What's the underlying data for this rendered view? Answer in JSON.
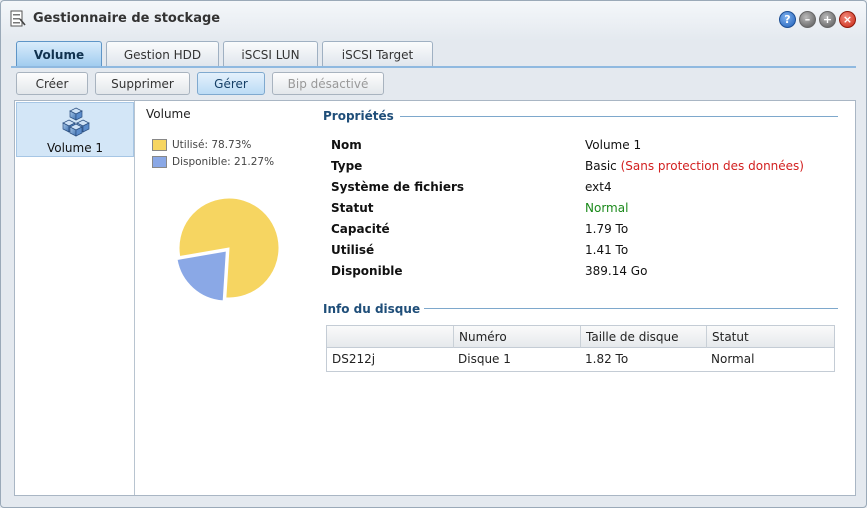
{
  "window": {
    "title": "Gestionnaire de stockage"
  },
  "tabs": [
    {
      "label": "Volume"
    },
    {
      "label": "Gestion HDD"
    },
    {
      "label": "iSCSI LUN"
    },
    {
      "label": "iSCSI Target"
    }
  ],
  "toolbar": {
    "create": "Créer",
    "delete": "Supprimer",
    "manage": "Gérer",
    "beep": "Bip désactivé"
  },
  "sidebar": {
    "items": [
      {
        "label": "Volume 1"
      }
    ]
  },
  "usage_chart": {
    "title": "Volume",
    "used_label": "Utilisé: 78.73%",
    "available_label": "Disponible: 21.27%",
    "used_fraction": 0.7873,
    "available_fraction": 0.2127,
    "used_color": "#f6d561",
    "available_color": "#8aa8e6"
  },
  "properties": {
    "section_title": "Propriétés",
    "rows": [
      {
        "key": "Nom",
        "value": "Volume 1"
      },
      {
        "key": "Type",
        "value": "Basic",
        "note": "(Sans protection des données)"
      },
      {
        "key": "Système de fichiers",
        "value": "ext4"
      },
      {
        "key": "Statut",
        "value": "Normal"
      },
      {
        "key": "Capacité",
        "value": "1.79 To"
      },
      {
        "key": "Utilisé",
        "value": "1.41 To"
      },
      {
        "key": "Disponible",
        "value": "389.14 Go"
      }
    ]
  },
  "disk_info": {
    "section_title": "Info du disque",
    "columns": [
      "",
      "Numéro",
      "Taille de disque",
      "Statut"
    ],
    "rows": [
      {
        "device": "DS212j",
        "number": "Disque 1",
        "size": "1.82 To",
        "status": "Normal"
      }
    ]
  }
}
